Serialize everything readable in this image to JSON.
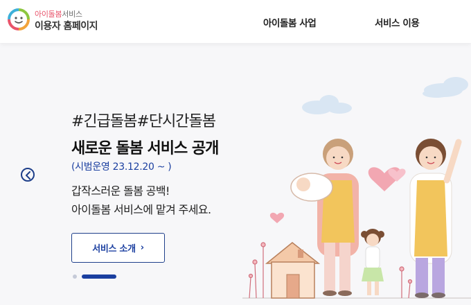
{
  "header": {
    "logo_line1_colored": "아이돌봄",
    "logo_line1_rest": "서비스",
    "logo_line2": "이용자 홈페이지",
    "nav": [
      {
        "label": "아이돌봄 사업"
      },
      {
        "label": "서비스 이용"
      }
    ]
  },
  "hero": {
    "hashtag": "#긴급돌봄#단시간돌봄",
    "headline": "새로운 돌봄 서비스 공개",
    "subnote": "(시범운영 23.12.20 ~ )",
    "desc_line1": "갑작스러운 돌봄 공백!",
    "desc_line2": "아이돌봄 서비스에 맡겨 주세요.",
    "cta_label": "서비스 소개",
    "cta_chevron": "›"
  },
  "carousel": {
    "total_slides": 2,
    "active_slide": 2
  },
  "colors": {
    "brand_blue": "#1b3fa0",
    "logo_pink": "#e8546b",
    "hero_bg": "#f7f7f9"
  },
  "icons": {
    "prev": "chevron-left-icon",
    "logo": "smiley-circle-logo"
  }
}
